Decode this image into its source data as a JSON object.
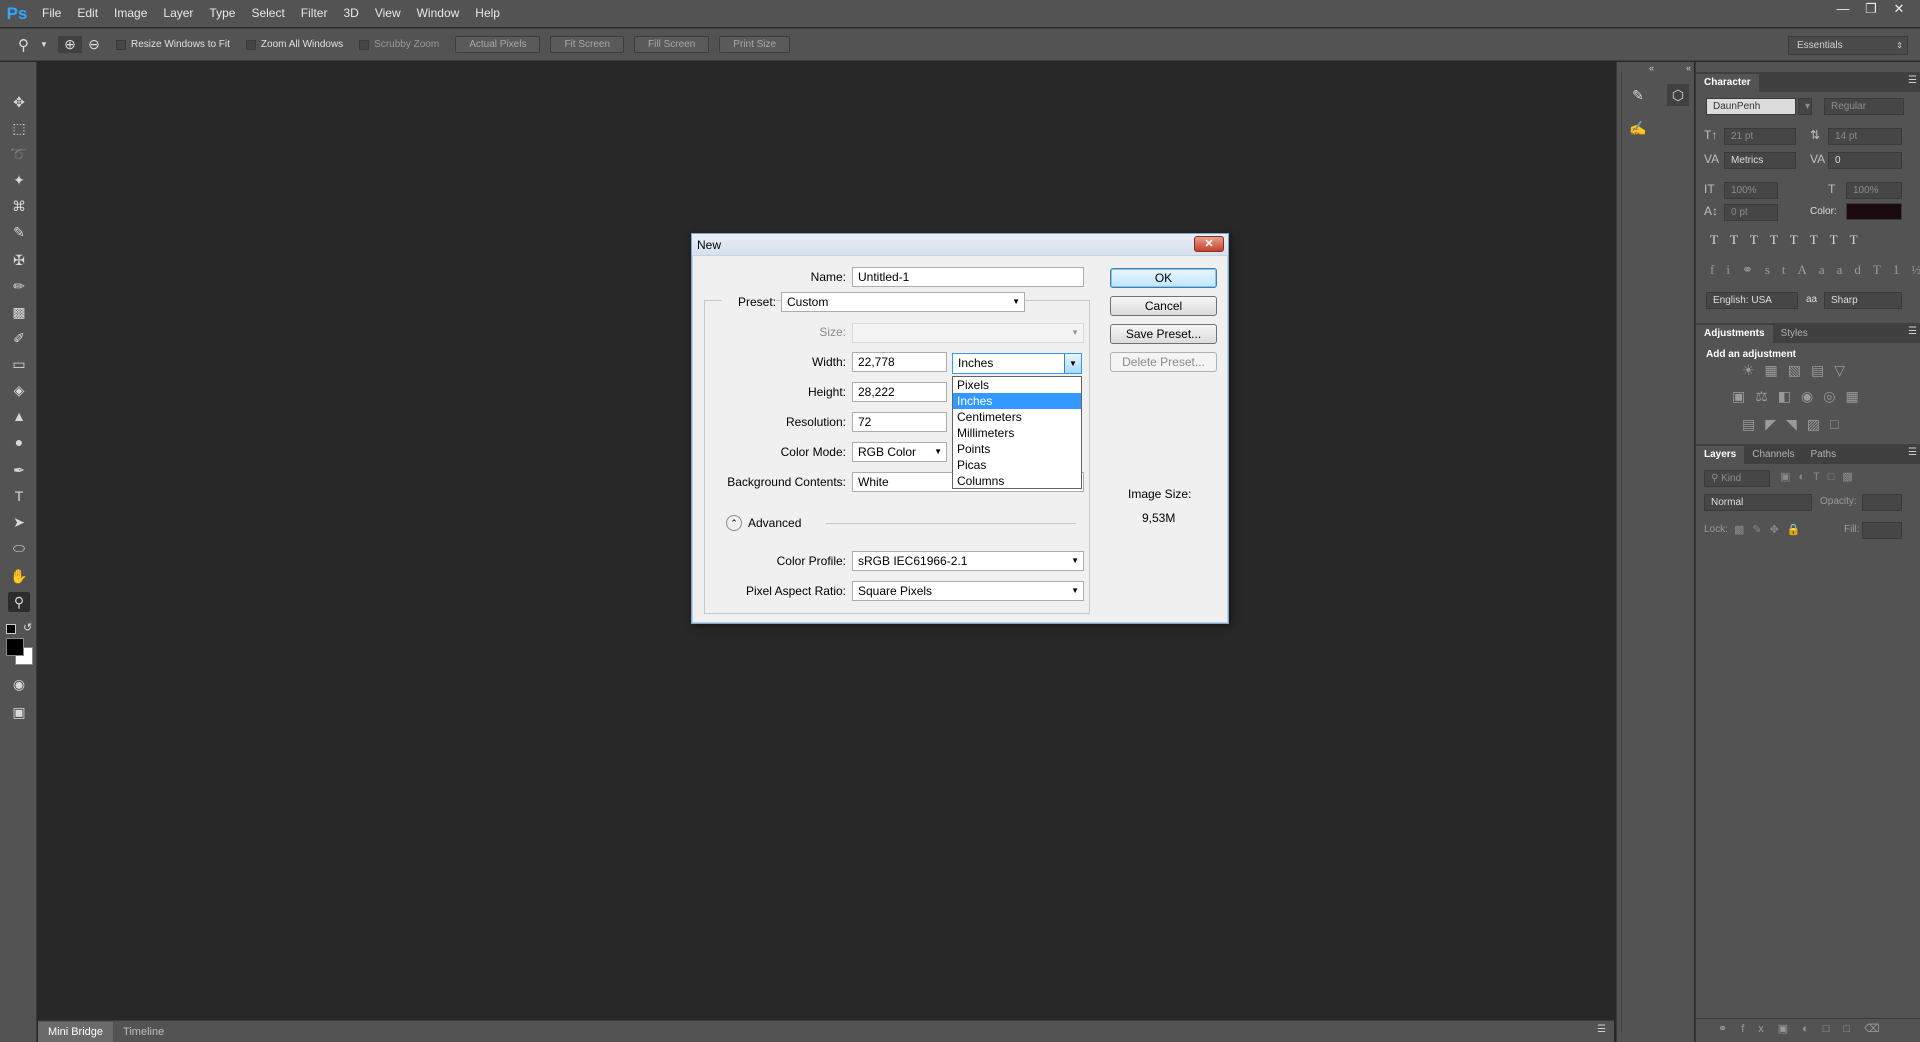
{
  "app": {
    "logo": "Ps"
  },
  "menu": [
    "File",
    "Edit",
    "Image",
    "Layer",
    "Type",
    "Select",
    "Filter",
    "3D",
    "View",
    "Window",
    "Help"
  ],
  "options_bar": {
    "resize_windows": "Resize Windows to Fit",
    "zoom_all": "Zoom All Windows",
    "scrubby_zoom": "Scrubby Zoom",
    "actual_pixels": "Actual Pixels",
    "fit_screen": "Fit Screen",
    "fill_screen": "Fill Screen",
    "print_size": "Print Size",
    "workspace": "Essentials"
  },
  "bottom_tabs": [
    "Mini Bridge",
    "Timeline"
  ],
  "character_panel": {
    "tab": "Character",
    "font": "DaunPenh",
    "style": "Regular",
    "size": "21 pt",
    "leading": "14 pt",
    "kerning": "Metrics",
    "tracking": "0",
    "vscale": "100%",
    "hscale": "100%",
    "baseline": "0 pt",
    "color_label": "Color:",
    "language": "English: USA",
    "aa_label": "aa",
    "antialias": "Sharp"
  },
  "adjustments_panel": {
    "tabs": [
      "Adjustments",
      "Styles"
    ],
    "heading": "Add an adjustment"
  },
  "layers_panel": {
    "tabs": [
      "Layers",
      "Channels",
      "Paths"
    ],
    "kind": "Kind",
    "blend": "Normal",
    "opacity_label": "Opacity:",
    "lock_label": "Lock:",
    "fill_label": "Fill:"
  },
  "dialog": {
    "title": "New",
    "name_label": "Name:",
    "name_value": "Untitled-1",
    "preset_label": "Preset:",
    "preset_value": "Custom",
    "size_label": "Size:",
    "width_label": "Width:",
    "width_value": "22,778",
    "height_label": "Height:",
    "height_value": "28,222",
    "resolution_label": "Resolution:",
    "resolution_value": "72",
    "color_mode_label": "Color Mode:",
    "color_mode_value": "RGB Color",
    "bg_label": "Background Contents:",
    "bg_value": "White",
    "advanced_label": "Advanced",
    "color_profile_label": "Color Profile:",
    "color_profile_value": "sRGB IEC61966-2.1",
    "pixel_aspect_label": "Pixel Aspect Ratio:",
    "pixel_aspect_value": "Square Pixels",
    "ok": "OK",
    "cancel": "Cancel",
    "save_preset": "Save Preset...",
    "delete_preset": "Delete Preset...",
    "image_size_label": "Image Size:",
    "image_size_value": "9,53M",
    "unit_value": "Inches",
    "unit_options": [
      "Pixels",
      "Inches",
      "Centimeters",
      "Millimeters",
      "Points",
      "Picas",
      "Columns"
    ],
    "unit_selected_index": 1
  }
}
